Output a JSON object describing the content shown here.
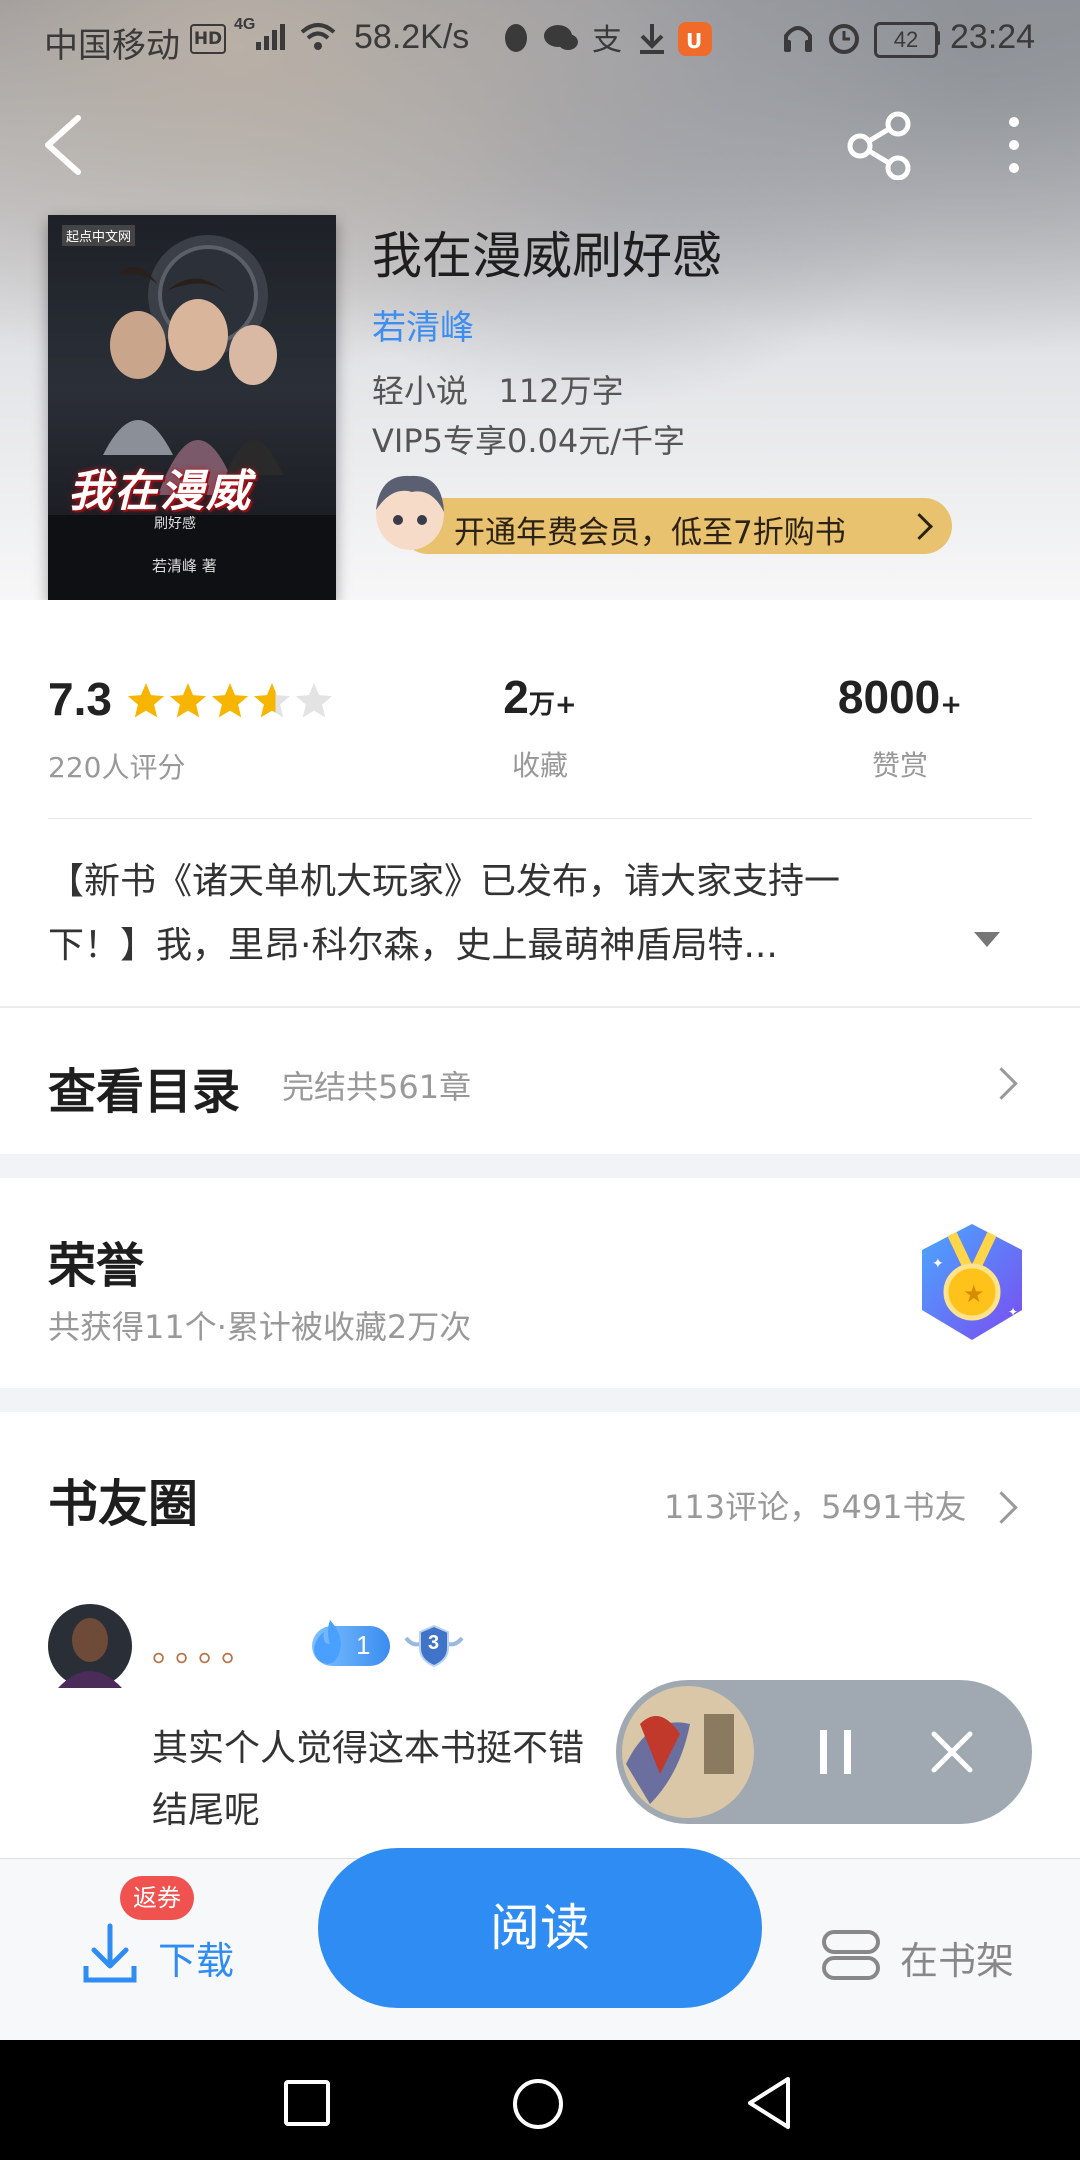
{
  "status_bar": {
    "carrier": "中国移动",
    "hd": "HD",
    "net": "4G",
    "speed": "58.2K/s",
    "battery": "42",
    "time": "23:24"
  },
  "header": {
    "back_icon": "back-arrow-icon",
    "share_icon": "share-icon",
    "more_icon": "more-vertical-icon"
  },
  "book": {
    "title": "我在漫威刷好感",
    "author": "若清峰",
    "meta": "轻小说   112万字",
    "price": "VIP5专享0.04元/千字",
    "promo": "开通年费会员，低至7折购书",
    "cover": {
      "publisher": "起点中文网",
      "title_big": "我在漫威",
      "subtitle": "刷好感",
      "author_line": "若清峰 著"
    }
  },
  "stats": {
    "rating": "7.3",
    "rating_value": 3.6,
    "rating_max": 5,
    "raters": "220人评分",
    "favorites_num": "2",
    "favorites_unit": "万+",
    "favorites_label": "收藏",
    "rewards_num": "8000",
    "rewards_unit": "+",
    "rewards_label": "赞赏"
  },
  "description": {
    "line1": "【新书《诸天单机大玩家》已发布，请大家支持一",
    "line2": "下！】我，里昂·科尔森，史上最萌神盾局特..."
  },
  "catalog": {
    "title": "查看目录",
    "info": "完结共561章"
  },
  "honor": {
    "title": "荣誉",
    "info": "共获得11个·累计被收藏2万次"
  },
  "circle": {
    "title": "书友圈",
    "summary": "113评论，5491书友",
    "comment": {
      "username": "。。。。",
      "fan_level": "1",
      "badge_level": "3",
      "text_line1": "其实个人觉得这本书挺不错",
      "text_line2": "结尾呢"
    }
  },
  "player": {
    "pause_icon": "pause-icon",
    "close_icon": "close-icon"
  },
  "bottom": {
    "coupon_badge": "返券",
    "download": "下载",
    "read": "阅读",
    "shelf": "在书架"
  },
  "colors": {
    "accent_blue": "#2e8cf3",
    "author_blue": "#3d8ef0",
    "promo_gold": "#e8c26e",
    "star": "#f7b500",
    "badge_red": "#f0524f"
  }
}
